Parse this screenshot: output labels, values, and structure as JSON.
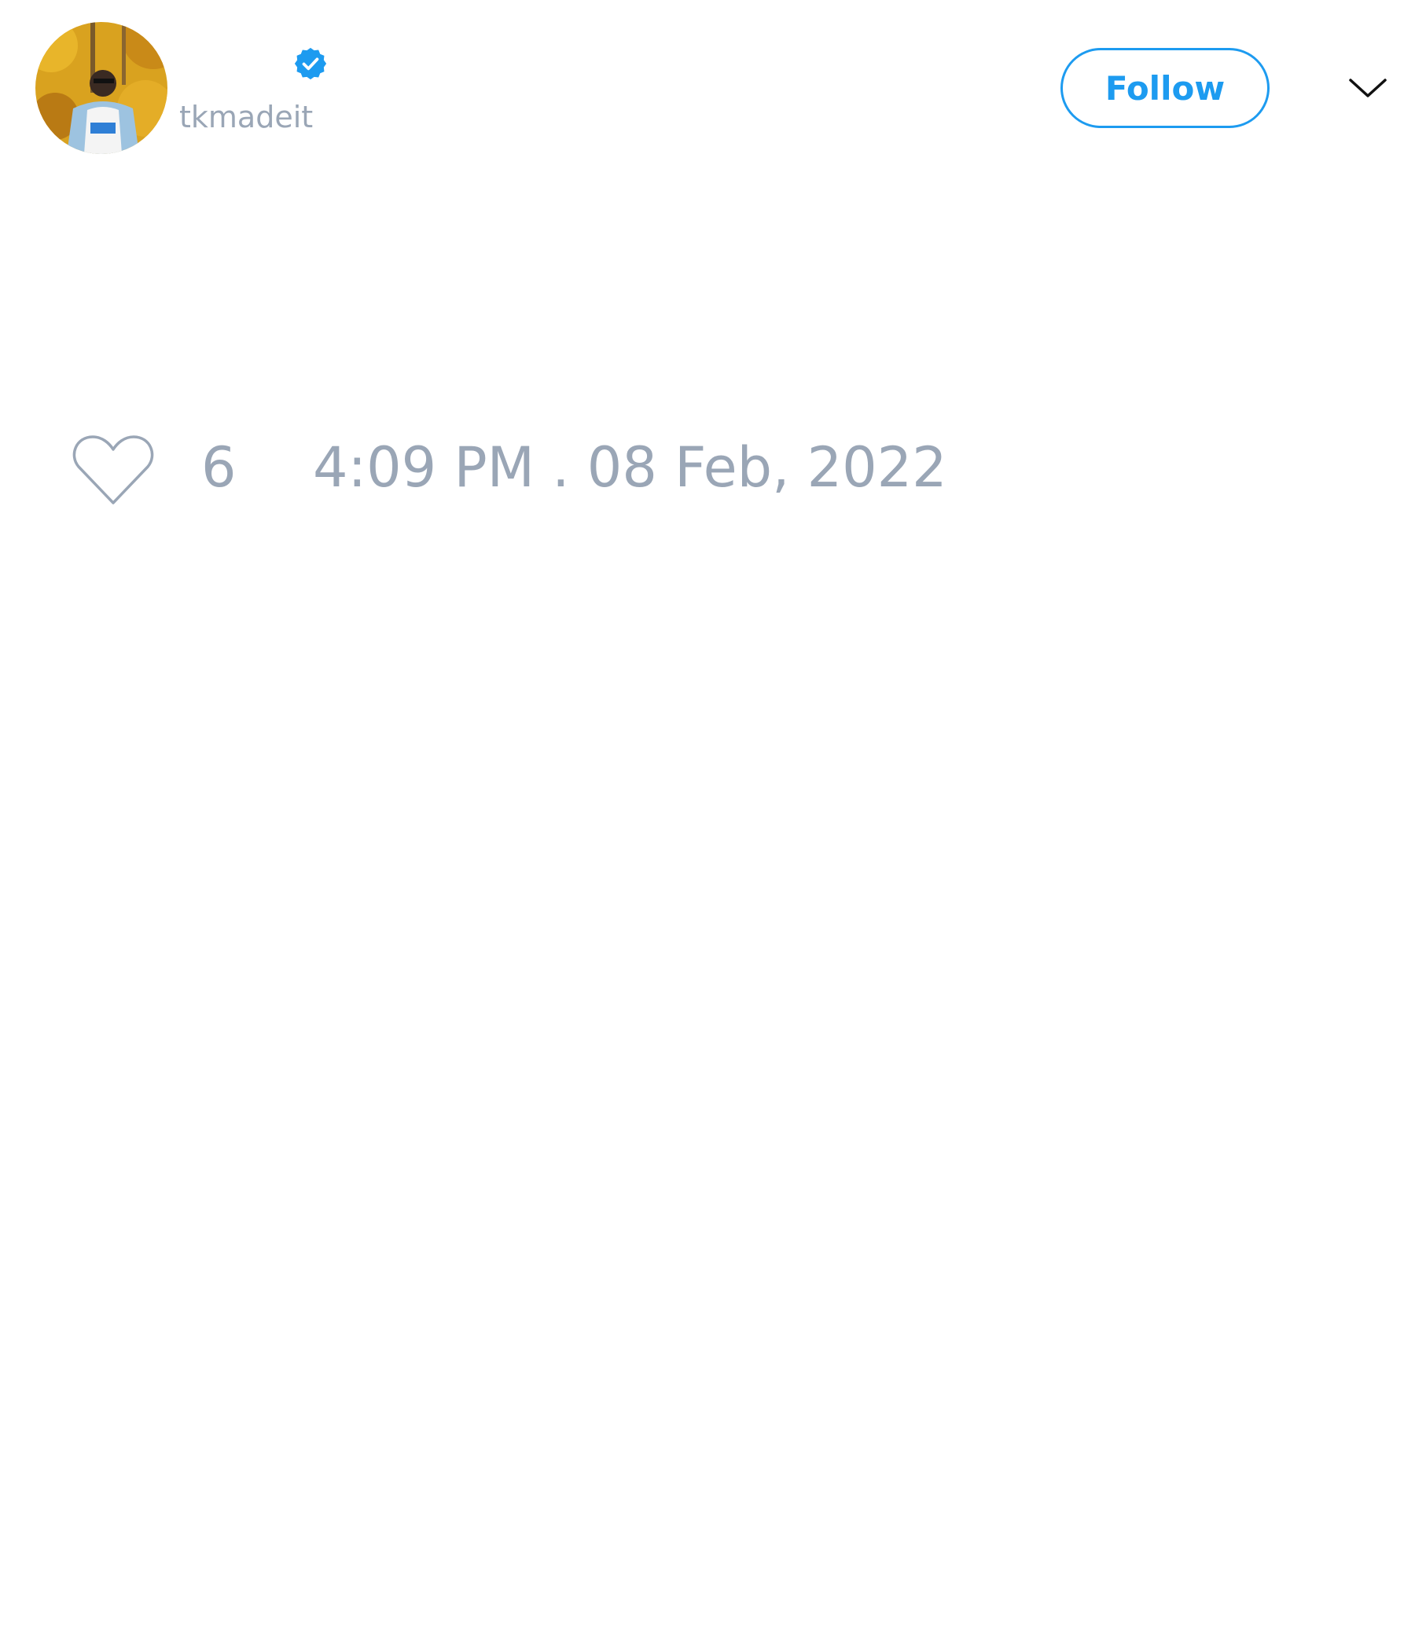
{
  "tweet": {
    "author": {
      "display_name": "",
      "handle": "tkmadeit",
      "verified": true,
      "avatar_icon": "profile-photo"
    },
    "follow_label": "Follow",
    "menu_icon": "chevron-down-icon",
    "like_icon": "heart-outline-icon",
    "like_count": "6",
    "timestamp": "4:09 PM . 08 Feb, 2022"
  },
  "colors": {
    "accent": "#1d9bf0",
    "muted_text": "#9aa6b6",
    "background": "#ffffff"
  }
}
